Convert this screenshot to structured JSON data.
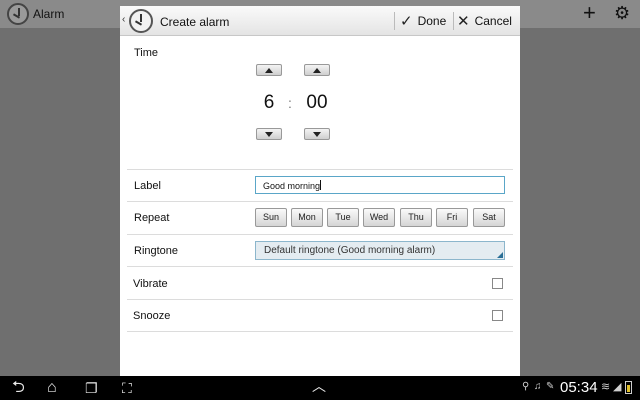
{
  "background_app": {
    "title": "Alarm",
    "actions": {
      "add_icon": "plus-icon",
      "settings_icon": "gear-icon"
    }
  },
  "dialog": {
    "title": "Create alarm",
    "done_label": "Done",
    "cancel_label": "Cancel"
  },
  "time": {
    "label": "Time",
    "hour": "6",
    "separator": ":",
    "minute": "00"
  },
  "label_row": {
    "label": "Label",
    "value": "Good morning"
  },
  "repeat": {
    "label": "Repeat",
    "days": [
      "Sun",
      "Mon",
      "Tue",
      "Wed",
      "Thu",
      "Fri",
      "Sat"
    ]
  },
  "ringtone": {
    "label": "Ringtone",
    "value": "Default ringtone (Good morning alarm)"
  },
  "vibrate": {
    "label": "Vibrate",
    "checked": false
  },
  "snooze": {
    "label": "Snooze",
    "checked": false
  },
  "system_bar": {
    "clock": "05:34",
    "colors": {
      "background": "#000000",
      "accent": "#33b5e5"
    }
  }
}
